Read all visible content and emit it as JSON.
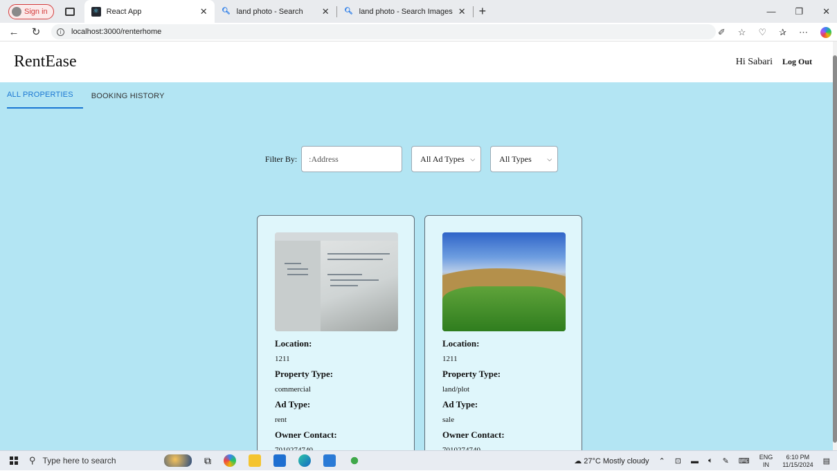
{
  "browser": {
    "signin_label": "Sign in",
    "tabs": [
      {
        "title": "React App",
        "active": true
      },
      {
        "title": "land photo - Search",
        "active": false
      },
      {
        "title": "land photo - Search Images",
        "active": false
      }
    ],
    "url": "localhost:3000/renterhome"
  },
  "app": {
    "brand": "RentEase",
    "greeting": "Hi Sabari",
    "logout_label": "Log Out",
    "tabs": [
      {
        "label": "ALL PROPERTIES",
        "selected": true
      },
      {
        "label": "BOOKING HISTORY",
        "selected": false
      }
    ],
    "filter": {
      "label": "Filter By:",
      "address_placeholder": ":Address",
      "ad_type_selected": "All Ad Types",
      "prop_type_selected": "All Types"
    },
    "labels": {
      "location": "Location:",
      "property_type": "Property Type:",
      "ad_type": "Ad Type:",
      "owner_contact": "Owner Contact:"
    },
    "properties": [
      {
        "location": "1211",
        "property_type": "commercial",
        "ad_type": "rent",
        "owner_contact": "7010274740",
        "image": "code-screen-photo"
      },
      {
        "location": "1211",
        "property_type": "land/plot",
        "ad_type": "sale",
        "owner_contact": "7010274740",
        "image": "green-hills-photo"
      }
    ]
  },
  "taskbar": {
    "search_placeholder": "Type here to search",
    "weather": "27°C  Mostly cloudy",
    "lang_top": "ENG",
    "lang_bottom": "IN",
    "time": "6:10 PM",
    "date": "11/15/2024"
  }
}
